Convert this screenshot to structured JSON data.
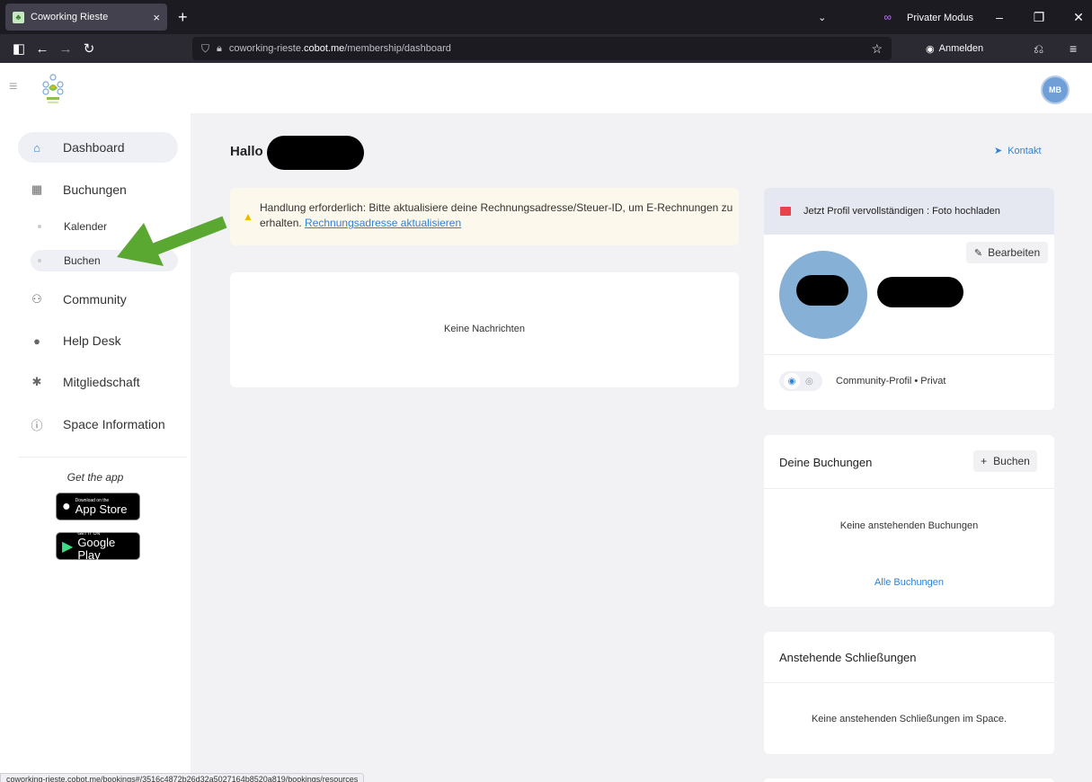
{
  "browser": {
    "tab_title": "Coworking Rieste",
    "tab_close": "×",
    "new_tab": "+",
    "private_mode": "Privater Modus",
    "url_prefix": "coworking-rieste.",
    "url_host": "cobot.me",
    "url_path": "/membership/dashboard",
    "account_label": "Anmelden"
  },
  "header": {
    "avatar_initials": "MB"
  },
  "sidebar": {
    "items": [
      {
        "label": "Dashboard",
        "icon": "home-icon"
      },
      {
        "label": "Buchungen",
        "icon": "calendar-icon"
      },
      {
        "label": "Community",
        "icon": "users-icon"
      },
      {
        "label": "Help Desk",
        "icon": "chat-icon"
      },
      {
        "label": "Mitgliedschaft",
        "icon": "gear-icon"
      },
      {
        "label": "Space Information",
        "icon": "info-icon"
      }
    ],
    "sub_items": [
      {
        "label": "Kalender"
      },
      {
        "label": "Buchen"
      }
    ],
    "get_app": "Get the app",
    "app_store": {
      "small": "Download on the",
      "large": "App Store"
    },
    "google_play": {
      "small": "GET IT ON",
      "large": "Google Play"
    }
  },
  "main": {
    "greeting": "Hallo",
    "kontakt": "Kontakt",
    "alert_text": "Handlung erforderlich: Bitte aktualisiere deine Rechnungsadresse/Steuer-ID, um E-Rechnungen zu erhalten.",
    "alert_link": "Rechnungsadresse aktualisieren",
    "no_messages": "Keine Nachrichten"
  },
  "profile_card": {
    "header": "Jetzt Profil vervollständigen : Foto hochladen",
    "edit": "Bearbeiten",
    "privacy": "Community-Profil • Privat"
  },
  "bookings_card": {
    "title": "Deine Buchungen",
    "book_button": "Buchen",
    "empty": "Keine anstehenden Buchungen",
    "all_link": "Alle Buchungen"
  },
  "closures_card": {
    "title": "Anstehende Schließungen",
    "empty": "Keine anstehenden Schließungen im Space."
  },
  "status_url": "coworking-rieste.cobot.me/bookings#/3516c4872b26d32a5027164b8520a819/bookings/resources",
  "colors": {
    "accent": "#2e82d6",
    "annotation_arrow": "#5aa832",
    "alert_bg": "#fdf8ec"
  }
}
